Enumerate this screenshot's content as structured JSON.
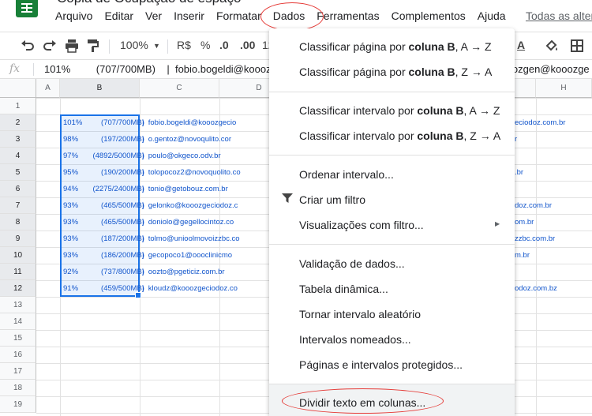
{
  "app": {
    "doc_title": "Cópia de Ocupação de espaço",
    "menus": [
      "Arquivo",
      "Editar",
      "Ver",
      "Inserir",
      "Formatar",
      "Dados",
      "Ferramentas",
      "Complementos",
      "Ajuda"
    ],
    "last_edit": "Todas as alter"
  },
  "toolbar": {
    "zoom": "100%",
    "currency": "R$",
    "percent": "%",
    "dec_less": ".0",
    "dec_more": ".00",
    "more_formats": "12",
    "text_color": "A"
  },
  "formula_bar": {
    "fx": "fx",
    "value": "101%         (707/700MB)    |  fobio.bogeldi@kooozgeciodoz.com.br",
    "value_right": "lozgen@kooozge"
  },
  "grid": {
    "columns": [
      "A",
      "B",
      "C",
      "D",
      "H"
    ],
    "rows": [
      "1",
      "2",
      "3",
      "4",
      "5",
      "6",
      "7",
      "8",
      "9",
      "10",
      "11",
      "12",
      "13",
      "14",
      "15",
      "16",
      "17",
      "18",
      "19"
    ],
    "cells": [
      {
        "b": "101%         (707/700MB)",
        "c": "|  fobio.bogeldi@kooozgecio",
        "r": "eciodoz.com.br"
      },
      {
        "b": "98%           (197/200MB)",
        "c": "|  o.gentoz@novoqulito.cor",
        "r": "r"
      },
      {
        "b": "97%       (4892/5000MB)",
        "c": "|  poulo@okgeco.odv.br",
        "r": ""
      },
      {
        "b": "95%           (190/200MB)",
        "c": "|  tolopocoz2@novoquolito.co",
        "r": ".br"
      },
      {
        "b": "94%       (2275/2400MB)",
        "c": "|  tonio@getobouz.com.br",
        "r": ""
      },
      {
        "b": "93%           (465/500MB)",
        "c": "|  gelonko@kooozgeciodoz.c",
        "r": "doz.com.br"
      },
      {
        "b": "93%           (465/500MB)",
        "c": "|  doniolo@gegellocintoz.co",
        "r": "om.br"
      },
      {
        "b": "93%           (187/200MB)",
        "c": "|  tolmo@unioolmovoizzbc.co",
        "r": "zzbc.com.br"
      },
      {
        "b": "93%           (186/200MB)",
        "c": "|  gecopoco1@oooclinicmo",
        "r": "m.br"
      },
      {
        "b": "92%           (737/800MB)",
        "c": "|  oozto@pgeticiz.com.br",
        "r": ""
      },
      {
        "b": "91%           (459/500MB)",
        "c": "|  kloudz@kooozgeciodoz.co",
        "r": "odoz.com.bz"
      }
    ]
  },
  "data_menu": {
    "sort_sheet_az": {
      "prefix": "Classificar página por ",
      "bold": "coluna B",
      "suffix": ", A → Z"
    },
    "sort_sheet_za": {
      "prefix": "Classificar página por ",
      "bold": "coluna B",
      "suffix": ", Z → A"
    },
    "sort_range_az": {
      "prefix": "Classificar intervalo por ",
      "bold": "coluna B",
      "suffix": ", A → Z"
    },
    "sort_range_za": {
      "prefix": "Classificar intervalo por ",
      "bold": "coluna B",
      "suffix": ", Z → A"
    },
    "sort_range": "Ordenar intervalo...",
    "create_filter": "Criar um filtro",
    "filter_views": "Visualizações com filtro...",
    "data_validation": "Validação de dados...",
    "pivot_table": "Tabela dinâmica...",
    "randomize_range": "Tornar intervalo aleatório",
    "named_ranges": "Intervalos nomeados...",
    "protected_ranges": "Páginas e intervalos protegidos...",
    "split_text": "Dividir texto em colunas..."
  }
}
